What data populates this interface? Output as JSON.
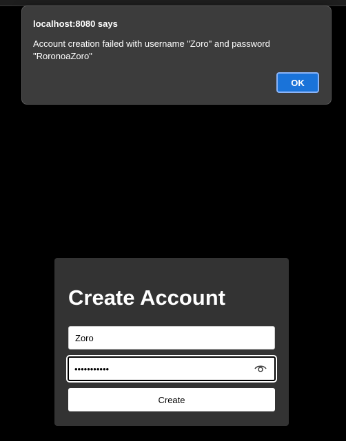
{
  "alert": {
    "title": "localhost:8080 says",
    "message": "Account creation failed with username \"Zoro\" and password \"RoronoaZoro\"",
    "ok_label": "OK"
  },
  "form": {
    "title": "Create Account",
    "username_value": "Zoro",
    "password_value": "RoronoaZoro",
    "password_visibility_icon": "eye-icon",
    "create_label": "Create"
  },
  "colors": {
    "page_background": "#000000",
    "dialog_background": "#3c3c3c",
    "dialog_button": "#1a73d9",
    "card_background": "#333333",
    "text_light": "#ffffff"
  }
}
